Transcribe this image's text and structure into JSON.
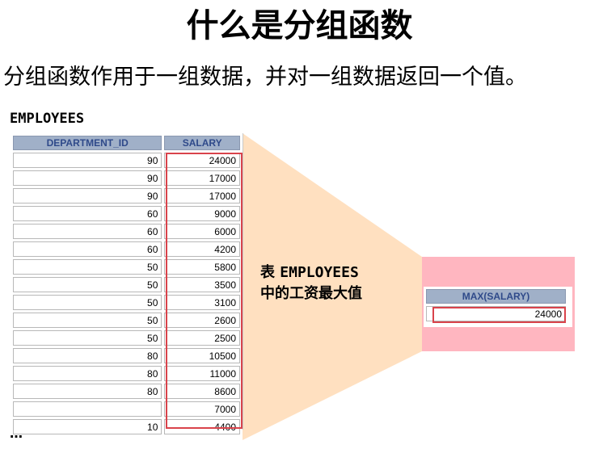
{
  "title": "什么是分组函数",
  "subtitle": "分组函数作用于一组数据，并对一组数据返回一个值。",
  "table_name": "EMPLOYEES",
  "employees": {
    "columns": [
      "DEPARTMENT_ID",
      "SALARY"
    ],
    "rows": [
      [
        "90",
        "24000"
      ],
      [
        "90",
        "17000"
      ],
      [
        "90",
        "17000"
      ],
      [
        "60",
        "9000"
      ],
      [
        "60",
        "6000"
      ],
      [
        "60",
        "4200"
      ],
      [
        "50",
        "5800"
      ],
      [
        "50",
        "3500"
      ],
      [
        "50",
        "3100"
      ],
      [
        "50",
        "2600"
      ],
      [
        "50",
        "2500"
      ],
      [
        "80",
        "10500"
      ],
      [
        "80",
        "11000"
      ],
      [
        "80",
        "8600"
      ],
      [
        "",
        "7000"
      ],
      [
        "10",
        "4400"
      ]
    ]
  },
  "ellipsis": "…",
  "annotation": {
    "line1_prefix": "表 ",
    "line1_table": "EMPLOYEES",
    "line2": "中的工资最大值"
  },
  "result": {
    "column": "MAX(SALARY)",
    "value": "24000"
  },
  "colors": {
    "header_bg": "#a0b0c8",
    "header_text": "#2f4a8a",
    "highlight_red": "#d9434b",
    "funnel_fill": "#ffe0c0",
    "panel_pink": "#ffb6c0"
  }
}
